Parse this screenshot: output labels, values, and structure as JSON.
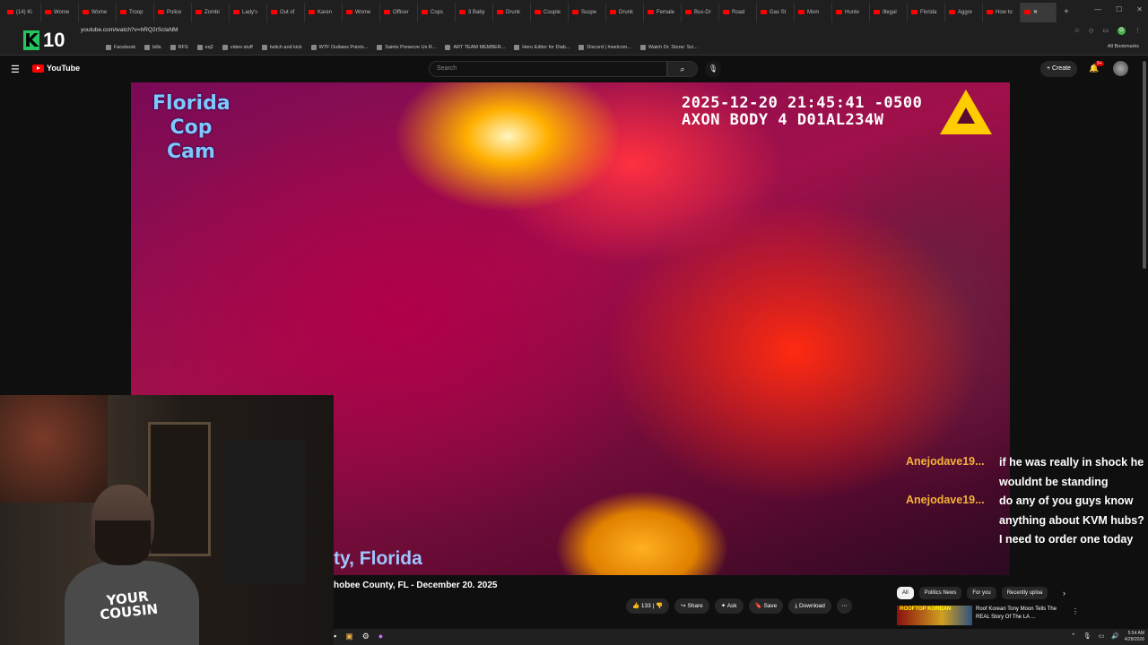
{
  "browser": {
    "tabs": [
      "(14) Ki",
      "Wome",
      "Wome",
      "Troop",
      "Police",
      "Zombi",
      "Lady's",
      "Out of",
      "Karen",
      "Wome",
      "Officer",
      "Cops",
      "3 Baby",
      "Drunk",
      "Couple",
      "Suspe",
      "Drunk",
      "Female",
      "Bus-Dr",
      "Road",
      "Gas St",
      "Mom",
      "Hunte",
      "Illegal",
      "Florida",
      "Aggre",
      "How to"
    ],
    "new_tab": "+",
    "url": "youtube.com/watch?v=hRQ2rSclaNM",
    "bookmarks": [
      "Facebook",
      "bills",
      "RFS",
      "eq2",
      "video stuff",
      "twitch and kick",
      "WTF Outlaws Points...",
      "Saints Preserve Us R...",
      "ART TEAM MEMBER...",
      "Hero Editor for Diab...",
      "Discord | #welcom...",
      "Watch Dr. Stone: Sci..."
    ],
    "all_bookmarks": "All Bookmarks",
    "profile_initial": "G"
  },
  "overlay_counter": {
    "letter": "K",
    "value": "10"
  },
  "youtube": {
    "logo": "YouTube",
    "search_placeholder": "Search",
    "create": "Create",
    "notif_count": "9+"
  },
  "video": {
    "brand_lines": [
      "Florida",
      "Cop",
      "Cam"
    ],
    "timestamp": "2025-12-20 21:45:41 -0500",
    "device": "AXON BODY 4 D01AL234W",
    "caption": "ty, Florida"
  },
  "chat": [
    {
      "name": "Anejodave19...",
      "text": "if he was really in shock he wouldnt be standing"
    },
    {
      "name": "Anejodave19...",
      "text": "do any of you guys know anything about KVM hubs? I need to order one today"
    }
  ],
  "webcam": {
    "shirt_text": "YOUR COUSIN"
  },
  "below": {
    "title": "hobee County, FL - December 20. 2025",
    "likes": "133",
    "share": "Share",
    "ask": "Ask",
    "save": "Save",
    "download": "Download"
  },
  "chips": [
    "All",
    "Politics News",
    "For you",
    "Recently uploa"
  ],
  "recommendation": {
    "thumb_text": "ROOFTOP KOREAN",
    "title": "Roof Korean Tony Moon Tells The REAL Story Of The LA ..."
  },
  "taskbar": {
    "time": "5:54 AM",
    "date": "4/28/2026"
  }
}
